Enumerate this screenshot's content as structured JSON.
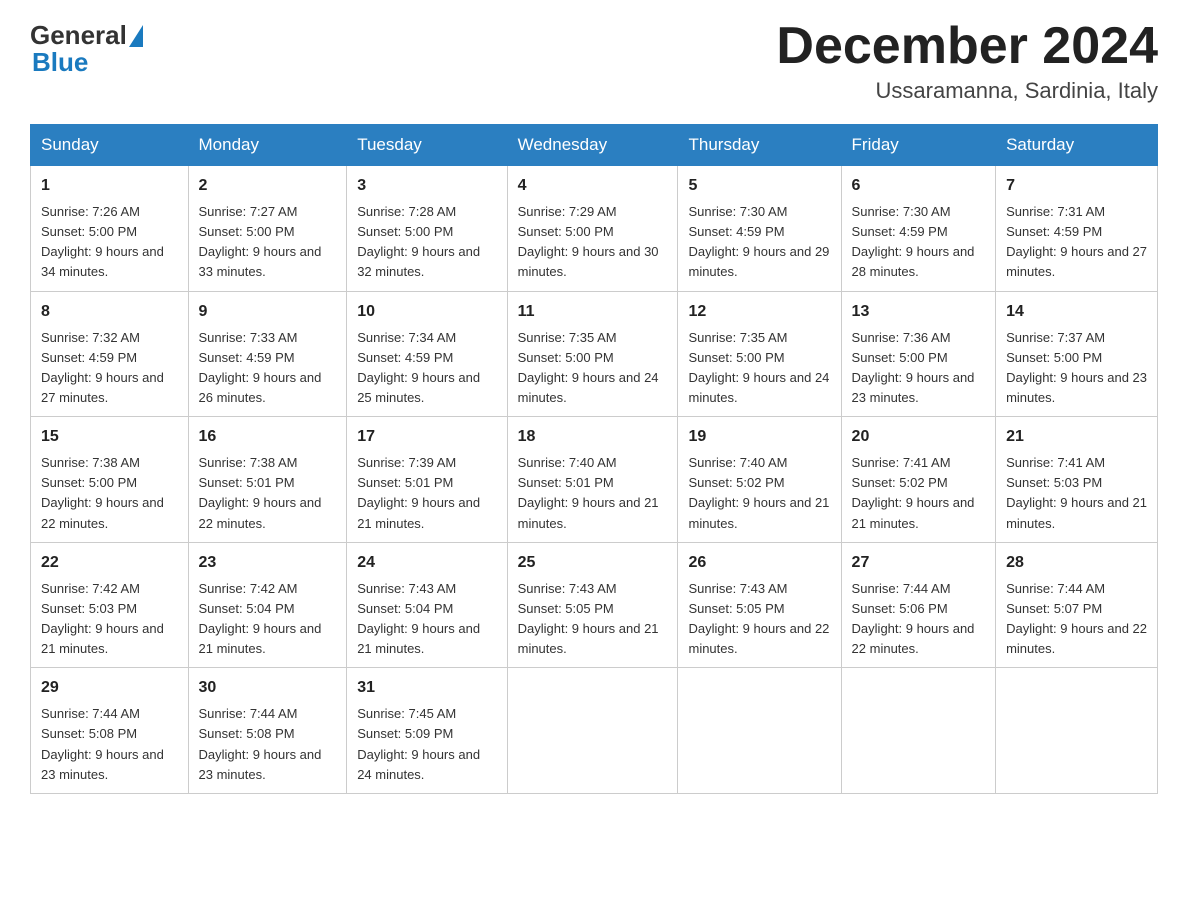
{
  "header": {
    "logo": {
      "general": "General",
      "blue": "Blue"
    },
    "title": "December 2024",
    "location": "Ussaramanna, Sardinia, Italy"
  },
  "days_of_week": [
    "Sunday",
    "Monday",
    "Tuesday",
    "Wednesday",
    "Thursday",
    "Friday",
    "Saturday"
  ],
  "weeks": [
    [
      {
        "day": "1",
        "sunrise": "7:26 AM",
        "sunset": "5:00 PM",
        "daylight": "9 hours and 34 minutes."
      },
      {
        "day": "2",
        "sunrise": "7:27 AM",
        "sunset": "5:00 PM",
        "daylight": "9 hours and 33 minutes."
      },
      {
        "day": "3",
        "sunrise": "7:28 AM",
        "sunset": "5:00 PM",
        "daylight": "9 hours and 32 minutes."
      },
      {
        "day": "4",
        "sunrise": "7:29 AM",
        "sunset": "5:00 PM",
        "daylight": "9 hours and 30 minutes."
      },
      {
        "day": "5",
        "sunrise": "7:30 AM",
        "sunset": "4:59 PM",
        "daylight": "9 hours and 29 minutes."
      },
      {
        "day": "6",
        "sunrise": "7:30 AM",
        "sunset": "4:59 PM",
        "daylight": "9 hours and 28 minutes."
      },
      {
        "day": "7",
        "sunrise": "7:31 AM",
        "sunset": "4:59 PM",
        "daylight": "9 hours and 27 minutes."
      }
    ],
    [
      {
        "day": "8",
        "sunrise": "7:32 AM",
        "sunset": "4:59 PM",
        "daylight": "9 hours and 27 minutes."
      },
      {
        "day": "9",
        "sunrise": "7:33 AM",
        "sunset": "4:59 PM",
        "daylight": "9 hours and 26 minutes."
      },
      {
        "day": "10",
        "sunrise": "7:34 AM",
        "sunset": "4:59 PM",
        "daylight": "9 hours and 25 minutes."
      },
      {
        "day": "11",
        "sunrise": "7:35 AM",
        "sunset": "5:00 PM",
        "daylight": "9 hours and 24 minutes."
      },
      {
        "day": "12",
        "sunrise": "7:35 AM",
        "sunset": "5:00 PM",
        "daylight": "9 hours and 24 minutes."
      },
      {
        "day": "13",
        "sunrise": "7:36 AM",
        "sunset": "5:00 PM",
        "daylight": "9 hours and 23 minutes."
      },
      {
        "day": "14",
        "sunrise": "7:37 AM",
        "sunset": "5:00 PM",
        "daylight": "9 hours and 23 minutes."
      }
    ],
    [
      {
        "day": "15",
        "sunrise": "7:38 AM",
        "sunset": "5:00 PM",
        "daylight": "9 hours and 22 minutes."
      },
      {
        "day": "16",
        "sunrise": "7:38 AM",
        "sunset": "5:01 PM",
        "daylight": "9 hours and 22 minutes."
      },
      {
        "day": "17",
        "sunrise": "7:39 AM",
        "sunset": "5:01 PM",
        "daylight": "9 hours and 21 minutes."
      },
      {
        "day": "18",
        "sunrise": "7:40 AM",
        "sunset": "5:01 PM",
        "daylight": "9 hours and 21 minutes."
      },
      {
        "day": "19",
        "sunrise": "7:40 AM",
        "sunset": "5:02 PM",
        "daylight": "9 hours and 21 minutes."
      },
      {
        "day": "20",
        "sunrise": "7:41 AM",
        "sunset": "5:02 PM",
        "daylight": "9 hours and 21 minutes."
      },
      {
        "day": "21",
        "sunrise": "7:41 AM",
        "sunset": "5:03 PM",
        "daylight": "9 hours and 21 minutes."
      }
    ],
    [
      {
        "day": "22",
        "sunrise": "7:42 AM",
        "sunset": "5:03 PM",
        "daylight": "9 hours and 21 minutes."
      },
      {
        "day": "23",
        "sunrise": "7:42 AM",
        "sunset": "5:04 PM",
        "daylight": "9 hours and 21 minutes."
      },
      {
        "day": "24",
        "sunrise": "7:43 AM",
        "sunset": "5:04 PM",
        "daylight": "9 hours and 21 minutes."
      },
      {
        "day": "25",
        "sunrise": "7:43 AM",
        "sunset": "5:05 PM",
        "daylight": "9 hours and 21 minutes."
      },
      {
        "day": "26",
        "sunrise": "7:43 AM",
        "sunset": "5:05 PM",
        "daylight": "9 hours and 22 minutes."
      },
      {
        "day": "27",
        "sunrise": "7:44 AM",
        "sunset": "5:06 PM",
        "daylight": "9 hours and 22 minutes."
      },
      {
        "day": "28",
        "sunrise": "7:44 AM",
        "sunset": "5:07 PM",
        "daylight": "9 hours and 22 minutes."
      }
    ],
    [
      {
        "day": "29",
        "sunrise": "7:44 AM",
        "sunset": "5:08 PM",
        "daylight": "9 hours and 23 minutes."
      },
      {
        "day": "30",
        "sunrise": "7:44 AM",
        "sunset": "5:08 PM",
        "daylight": "9 hours and 23 minutes."
      },
      {
        "day": "31",
        "sunrise": "7:45 AM",
        "sunset": "5:09 PM",
        "daylight": "9 hours and 24 minutes."
      },
      null,
      null,
      null,
      null
    ]
  ]
}
